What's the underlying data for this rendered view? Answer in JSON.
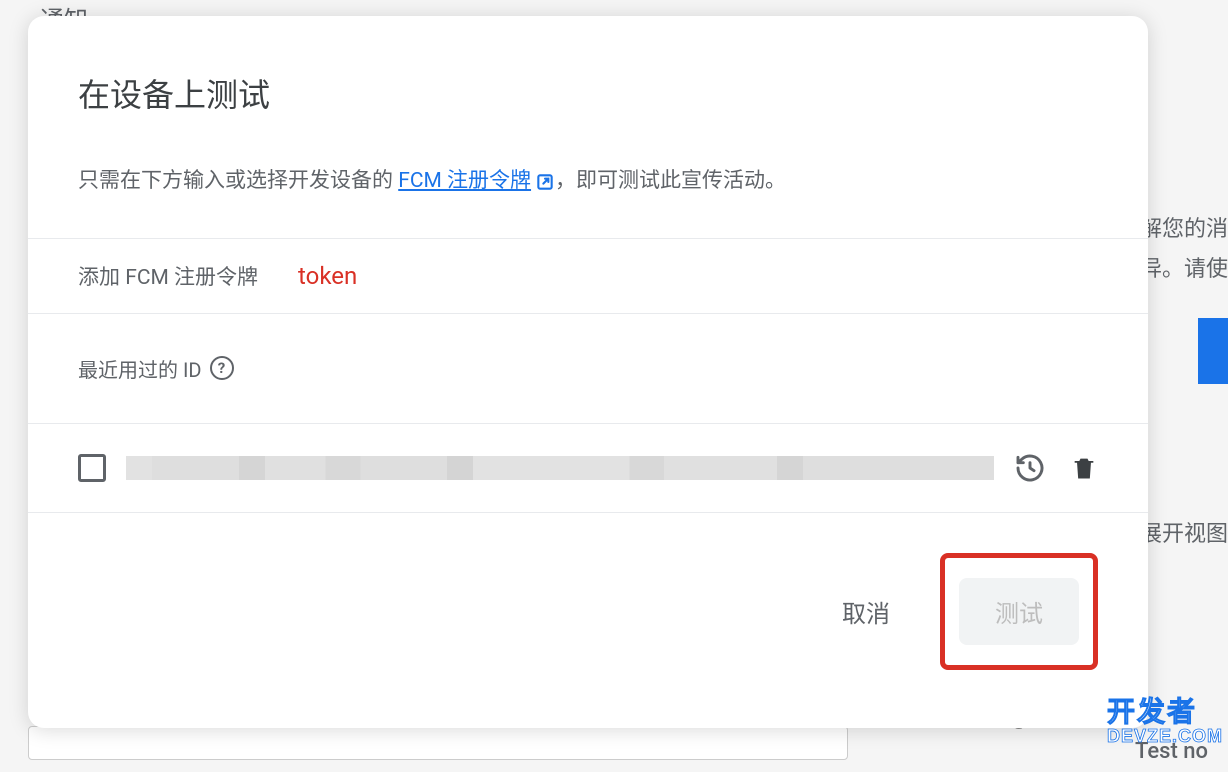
{
  "background": {
    "header": "通知",
    "right_text_1": "解您的消",
    "right_text_2": "异。请使",
    "expand_view": "展开视图",
    "test_no": "Test no",
    "at_symbol": "@t"
  },
  "modal": {
    "title": "在设备上测试",
    "description_prefix": "只需在下方输入或选择开发设备的 ",
    "fcm_link_text": "FCM 注册令牌",
    "description_suffix": "，即可测试此宣传活动。",
    "input_label": "添加 FCM 注册令牌",
    "token_annotation": "token",
    "recent_label": "最近用过的 ID",
    "footer": {
      "cancel": "取消",
      "test": "测试"
    }
  },
  "watermark": {
    "line1": "开发者",
    "line2": "DEVZE.COM"
  }
}
